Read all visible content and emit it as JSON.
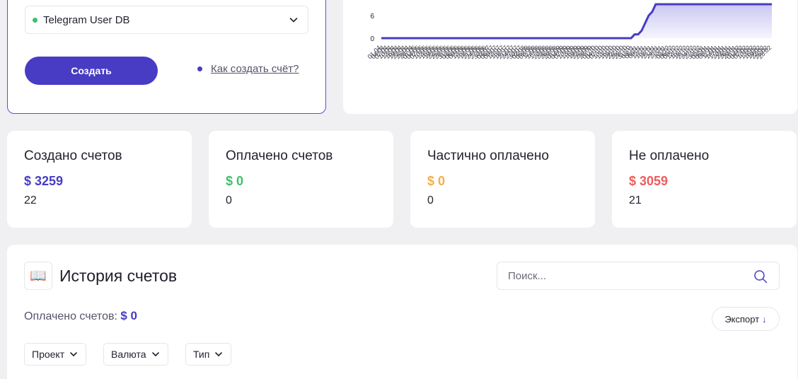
{
  "create": {
    "project_name": "Telegram User DB",
    "create_button": "Создать",
    "howto_link": "Как создать счёт?"
  },
  "chart_data": {
    "type": "area",
    "color": "#473cc3",
    "y_ticks": [
      "6",
      "0"
    ],
    "x_ticks": [
      "01.04",
      "04.04",
      "07.04",
      "10.04",
      "13.04",
      "16.04",
      "19.04",
      "22.04",
      "25.04",
      "28.04",
      "01.05",
      "04.05",
      "07.05",
      "10.05",
      "13.05",
      "16.05",
      "19.05",
      "22.05",
      "25.05",
      "28.05",
      "31.05",
      "03.06",
      "06.06",
      "09.06",
      "12.06",
      "15.06",
      "18.06",
      "21.06",
      "24.06",
      "27.06",
      "30.06",
      "03.07",
      "06.07",
      "09.07",
      "12.07",
      "15.07",
      "18.07",
      "21.07",
      "24.07",
      "27.07",
      "30.07",
      "02.08",
      "05.08",
      "08.08",
      "11.08",
      "14.08",
      "17.08",
      "20.08",
      "23.08",
      "26.08",
      "29.08",
      "01.09",
      "04.09",
      "07.09",
      "10.09",
      "13.09",
      "16.09",
      "19.09",
      "22.09",
      "25.09",
      "28.09",
      "01.10",
      "04.10",
      "07.10",
      "10.10",
      "13.10",
      "16.10",
      "19.10",
      "22.10",
      "25.10",
      "28.10",
      "31.10",
      "03.11",
      "06.11",
      "09.11",
      "12.11",
      "15.11",
      "18.11",
      "21.11",
      "24.11",
      "27.11",
      "30.11",
      "03.12",
      "06.12",
      "09.12",
      "12.12",
      "15.12",
      "18.12",
      "21.12",
      "24.12",
      "27.12",
      "30.12",
      "02.01",
      "05.01",
      "08.01",
      "11.01",
      "14.01",
      "17.01",
      "20.01",
      "23.01",
      "26.01",
      "29.01",
      "01.02",
      "04.02",
      "07.02",
      "10.02",
      "13.02",
      "16.02",
      "19.02",
      "22.02",
      "25.02",
      "28.02"
    ],
    "ylim": [
      0,
      9
    ],
    "values_tail": [
      0,
      0,
      0,
      1,
      1,
      2,
      4,
      6,
      7,
      9,
      9,
      9,
      9,
      9,
      9,
      9,
      9,
      9,
      9,
      9,
      9,
      9,
      9,
      9,
      9,
      9,
      9,
      9,
      9,
      9,
      9,
      9,
      9,
      9,
      9,
      9,
      9,
      9,
      9,
      9,
      9,
      9,
      9
    ]
  },
  "stats": [
    {
      "title": "Создано счетов",
      "amount": "$ 3259",
      "count": "22",
      "color": "#473cc3"
    },
    {
      "title": "Оплачено счетов",
      "amount": "$ 0",
      "count": "0",
      "color": "#3ec06c"
    },
    {
      "title": "Частично оплачено",
      "amount": "$ 0",
      "count": "0",
      "color": "#f2b04a"
    },
    {
      "title": "Не оплачено",
      "amount": "$ 3059",
      "count": "21",
      "color": "#ef5b5b"
    }
  ],
  "history": {
    "icon": "book-icon",
    "title": "История счетов",
    "search_placeholder": "Поиск...",
    "paid_label": "Оплачено счетов:",
    "paid_value": "$ 0",
    "export_label": "Экспорт",
    "filters": [
      "Проект",
      "Валюта",
      "Тип"
    ]
  }
}
